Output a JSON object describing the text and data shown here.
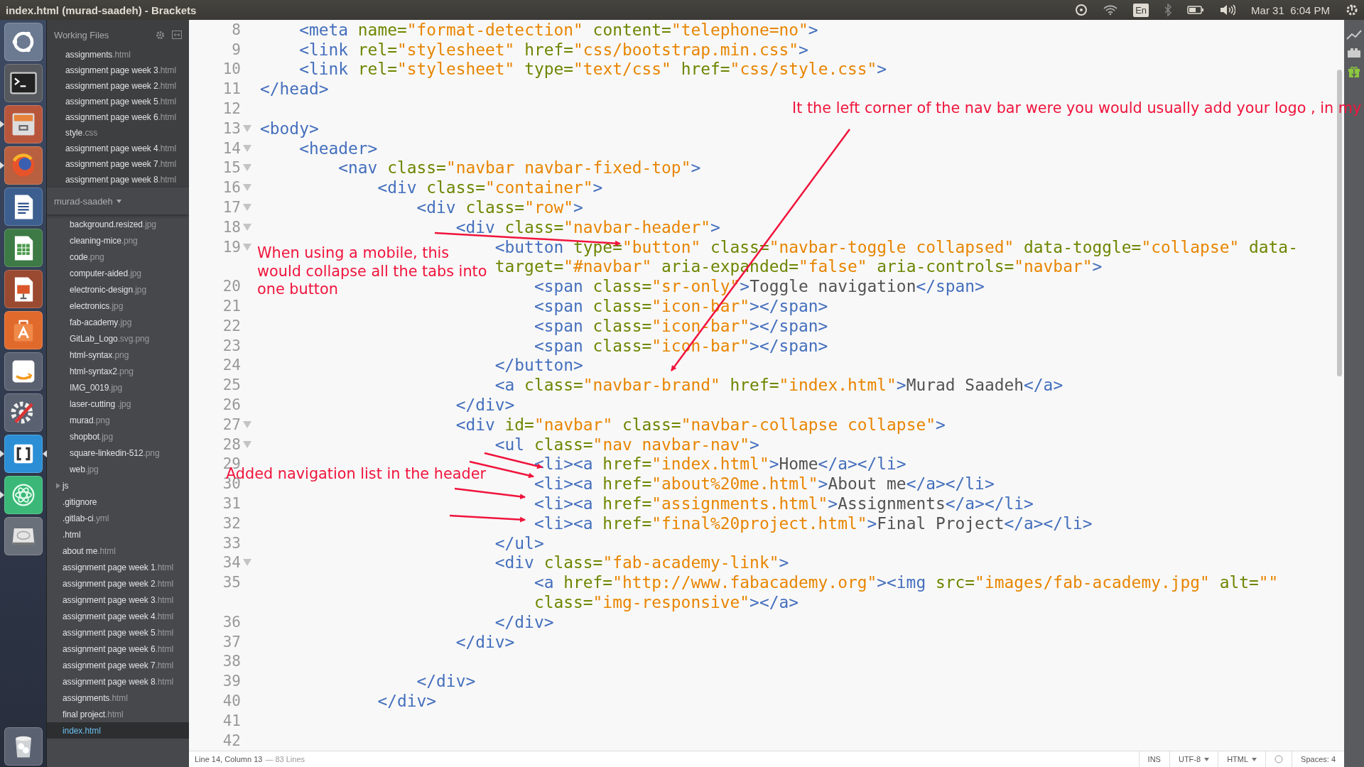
{
  "window": {
    "title": "index.html (murad-saadeh) - Brackets"
  },
  "panel": {
    "keyboard_layout": "En",
    "clock": "Mar 31  6:04 PM"
  },
  "launcher": [
    {
      "kind": "dash",
      "running": false,
      "focused": false
    },
    {
      "kind": "terminal",
      "running": false,
      "focused": false
    },
    {
      "kind": "files",
      "running": true,
      "focused": false
    },
    {
      "kind": "firefox",
      "running": true,
      "focused": false
    },
    {
      "kind": "writer",
      "running": false,
      "focused": false
    },
    {
      "kind": "calc",
      "running": false,
      "focused": false
    },
    {
      "kind": "impress",
      "running": false,
      "focused": false
    },
    {
      "kind": "software",
      "running": false,
      "focused": false
    },
    {
      "kind": "amazon",
      "running": false,
      "focused": false
    },
    {
      "kind": "settings",
      "running": false,
      "focused": false
    },
    {
      "kind": "brackets",
      "running": true,
      "focused": true
    },
    {
      "kind": "atom",
      "running": true,
      "focused": false
    },
    {
      "kind": "disk",
      "running": false,
      "focused": false
    },
    {
      "kind": "trash",
      "running": false,
      "focused": false
    }
  ],
  "sidebar": {
    "working_files_title": "Working Files",
    "working_files": [
      {
        "name": "assignments",
        "ext": ".html",
        "selected": false
      },
      {
        "name": "assignment page week 3",
        "ext": ".html",
        "selected": false
      },
      {
        "name": "assignment page week 2",
        "ext": ".html",
        "selected": false
      },
      {
        "name": "assignment page week 5",
        "ext": ".html",
        "selected": false
      },
      {
        "name": "assignment page week 6",
        "ext": ".html",
        "selected": false
      },
      {
        "name": "style",
        "ext": ".css",
        "selected": false
      },
      {
        "name": "assignment page week 4",
        "ext": ".html",
        "selected": false
      },
      {
        "name": "assignment page week 7",
        "ext": ".html",
        "selected": false
      },
      {
        "name": "assignment page week 8",
        "ext": ".html",
        "selected": false
      }
    ],
    "project_title": "murad-saadeh",
    "nested_files": [
      {
        "name": "background.resized",
        "ext": ".jpg",
        "selected": false
      },
      {
        "name": "cleaning-mice",
        "ext": ".png",
        "selected": false
      },
      {
        "name": "code",
        "ext": ".png",
        "selected": false
      },
      {
        "name": "computer-aided",
        "ext": ".jpg",
        "selected": false
      },
      {
        "name": "electronic-design",
        "ext": ".jpg",
        "selected": false
      },
      {
        "name": "electronics",
        "ext": ".jpg",
        "selected": false
      },
      {
        "name": "fab-academy",
        "ext": ".jpg",
        "selected": false
      },
      {
        "name": "GitLab_Logo",
        "ext": ".svg.png",
        "selected": false
      },
      {
        "name": "html-syntax",
        "ext": ".png",
        "selected": false
      },
      {
        "name": "html-syntax2",
        "ext": ".png",
        "selected": false
      },
      {
        "name": "IMG_0019",
        "ext": ".jpg",
        "selected": false
      },
      {
        "name": "laser-cutting ",
        "ext": ".jpg",
        "selected": false
      },
      {
        "name": "murad",
        "ext": ".png",
        "selected": false
      },
      {
        "name": "shopbot",
        "ext": ".jpg",
        "selected": false
      },
      {
        "name": "square-linkedin-512",
        "ext": ".png",
        "selected": false
      },
      {
        "name": "web",
        "ext": ".jpg",
        "selected": false
      }
    ],
    "project_items": [
      {
        "kind": "folder",
        "name": "js",
        "expanded": false,
        "selected": false
      },
      {
        "kind": "file",
        "name": ".gitignore",
        "selected": false
      },
      {
        "kind": "file",
        "name": ".gitlab-ci",
        "ext": ".yml",
        "selected": false
      },
      {
        "kind": "file",
        "name": ".html",
        "selected": false
      },
      {
        "kind": "file",
        "name": "about me",
        "ext": ".html",
        "selected": false
      },
      {
        "kind": "file",
        "name": "assignment page week 1",
        "ext": ".html",
        "selected": false
      },
      {
        "kind": "file",
        "name": "assignment page week 2",
        "ext": ".html",
        "selected": false
      },
      {
        "kind": "file",
        "name": "assignment page week 3",
        "ext": ".html",
        "selected": false
      },
      {
        "kind": "file",
        "name": "assignment page week 4",
        "ext": ".html",
        "selected": false
      },
      {
        "kind": "file",
        "name": "assignment page week 5",
        "ext": ".html",
        "selected": false
      },
      {
        "kind": "file",
        "name": "assignment page week 6",
        "ext": ".html",
        "selected": false
      },
      {
        "kind": "file",
        "name": "assignment page week 7",
        "ext": ".html",
        "selected": false
      },
      {
        "kind": "file",
        "name": "assignment page week 8",
        "ext": ".html",
        "selected": false
      },
      {
        "kind": "file",
        "name": "assignments",
        "ext": ".html",
        "selected": false
      },
      {
        "kind": "file",
        "name": "final project",
        "ext": ".html",
        "selected": false
      },
      {
        "kind": "file",
        "name": "index.html",
        "selected": true
      }
    ]
  },
  "code_lines": [
    {
      "number": "8",
      "fold": false,
      "segments": [
        {
          "kind": "tag",
          "text": "    <meta"
        },
        {
          "kind": "attr",
          "text": " name="
        },
        {
          "kind": "str",
          "text": "\"format-detection\""
        },
        {
          "kind": "attr",
          "text": " content="
        },
        {
          "kind": "str",
          "text": "\"telephone=no\""
        },
        {
          "kind": "tag",
          "text": ">"
        }
      ]
    },
    {
      "number": "9",
      "fold": false,
      "segments": [
        {
          "kind": "tag",
          "text": "    <link"
        },
        {
          "kind": "attr",
          "text": " rel="
        },
        {
          "kind": "str",
          "text": "\"stylesheet\""
        },
        {
          "kind": "attr",
          "text": " href="
        },
        {
          "kind": "str",
          "text": "\"css/bootstrap.min.css\""
        },
        {
          "kind": "tag",
          "text": ">"
        }
      ]
    },
    {
      "number": "10",
      "fold": false,
      "segments": [
        {
          "kind": "tag",
          "text": "    <link"
        },
        {
          "kind": "attr",
          "text": " rel="
        },
        {
          "kind": "str",
          "text": "\"stylesheet\""
        },
        {
          "kind": "attr",
          "text": " type="
        },
        {
          "kind": "str",
          "text": "\"text/css\""
        },
        {
          "kind": "attr",
          "text": " href="
        },
        {
          "kind": "str",
          "text": "\"css/style.css\""
        },
        {
          "kind": "tag",
          "text": ">"
        }
      ]
    },
    {
      "number": "11",
      "fold": false,
      "segments": [
        {
          "kind": "tag",
          "text": "</head>"
        }
      ]
    },
    {
      "number": "12",
      "fold": false
    },
    {
      "number": "13",
      "fold": true,
      "segments": [
        {
          "kind": "tag",
          "text": "<body>"
        }
      ]
    },
    {
      "number": "14",
      "fold": true,
      "segments": [
        {
          "kind": "tag",
          "text": "    <header>"
        }
      ]
    },
    {
      "number": "15",
      "fold": true,
      "segments": [
        {
          "kind": "tag",
          "text": "        <nav"
        },
        {
          "kind": "attr",
          "text": " class="
        },
        {
          "kind": "str",
          "text": "\"navbar navbar-fixed-top\""
        },
        {
          "kind": "tag",
          "text": ">"
        }
      ]
    },
    {
      "number": "16",
      "fold": true,
      "segments": [
        {
          "kind": "tag",
          "text": "            <div"
        },
        {
          "kind": "attr",
          "text": " class="
        },
        {
          "kind": "str",
          "text": "\"container\""
        },
        {
          "kind": "tag",
          "text": ">"
        }
      ]
    },
    {
      "number": "17",
      "fold": true,
      "segments": [
        {
          "kind": "tag",
          "text": "                <div"
        },
        {
          "kind": "attr",
          "text": " class="
        },
        {
          "kind": "str",
          "text": "\"row\""
        },
        {
          "kind": "tag",
          "text": ">"
        }
      ]
    },
    {
      "number": "18",
      "fold": true,
      "segments": [
        {
          "kind": "tag",
          "text": "                    <div"
        },
        {
          "kind": "attr",
          "text": " class="
        },
        {
          "kind": "str",
          "text": "\"navbar-header\""
        },
        {
          "kind": "tag",
          "text": ">"
        }
      ]
    },
    {
      "number": "19",
      "fold": true,
      "segments": [
        {
          "kind": "tag",
          "text": "                        <button"
        },
        {
          "kind": "attr",
          "text": " type="
        },
        {
          "kind": "str",
          "text": "\"button\""
        },
        {
          "kind": "attr",
          "text": " class="
        },
        {
          "kind": "str",
          "text": "\"navbar-toggle collapsed\""
        },
        {
          "kind": "attr",
          "text": " data-toggle="
        },
        {
          "kind": "str",
          "text": "\"collapse\""
        },
        {
          "kind": "attr",
          "text": " data-"
        }
      ]
    },
    {
      "segments": [
        {
          "kind": "attr",
          "text": "                        target="
        },
        {
          "kind": "str",
          "text": "\"#navbar\""
        },
        {
          "kind": "attr",
          "text": " aria-expanded="
        },
        {
          "kind": "str",
          "text": "\"false\""
        },
        {
          "kind": "attr",
          "text": " aria-controls="
        },
        {
          "kind": "str",
          "text": "\"navbar\""
        },
        {
          "kind": "tag",
          "text": ">"
        }
      ]
    },
    {
      "number": "20",
      "fold": false,
      "segments": [
        {
          "kind": "tag",
          "text": "                            <span"
        },
        {
          "kind": "attr",
          "text": " class="
        },
        {
          "kind": "str",
          "text": "\"sr-only\""
        },
        {
          "kind": "tag",
          "text": ">"
        },
        {
          "kind": "text",
          "text": "Toggle navigation"
        },
        {
          "kind": "tag",
          "text": "</span>"
        }
      ]
    },
    {
      "number": "21",
      "fold": false,
      "segments": [
        {
          "kind": "tag",
          "text": "                            <span"
        },
        {
          "kind": "attr",
          "text": " class="
        },
        {
          "kind": "str",
          "text": "\"icon-bar\""
        },
        {
          "kind": "tag",
          "text": "></span>"
        }
      ]
    },
    {
      "number": "22",
      "fold": false,
      "segments": [
        {
          "kind": "tag",
          "text": "                            <span"
        },
        {
          "kind": "attr",
          "text": " class="
        },
        {
          "kind": "str",
          "text": "\"icon-bar\""
        },
        {
          "kind": "tag",
          "text": "></span>"
        }
      ]
    },
    {
      "number": "23",
      "fold": false,
      "segments": [
        {
          "kind": "tag",
          "text": "                            <span"
        },
        {
          "kind": "attr",
          "text": " class="
        },
        {
          "kind": "str",
          "text": "\"icon-bar\""
        },
        {
          "kind": "tag",
          "text": "></span>"
        }
      ]
    },
    {
      "number": "24",
      "fold": false,
      "segments": [
        {
          "kind": "tag",
          "text": "                        </button>"
        }
      ]
    },
    {
      "number": "25",
      "fold": false,
      "segments": [
        {
          "kind": "tag",
          "text": "                        <a"
        },
        {
          "kind": "attr",
          "text": " class="
        },
        {
          "kind": "str",
          "text": "\"navbar-brand\""
        },
        {
          "kind": "attr",
          "text": " href="
        },
        {
          "kind": "str",
          "text": "\"index.html\""
        },
        {
          "kind": "tag",
          "text": ">"
        },
        {
          "kind": "text",
          "text": "Murad Saadeh"
        },
        {
          "kind": "tag",
          "text": "</a>"
        }
      ]
    },
    {
      "number": "26",
      "fold": false,
      "segments": [
        {
          "kind": "tag",
          "text": "                    </div>"
        }
      ]
    },
    {
      "number": "27",
      "fold": true,
      "segments": [
        {
          "kind": "tag",
          "text": "                    <div"
        },
        {
          "kind": "attr",
          "text": " id="
        },
        {
          "kind": "str",
          "text": "\"navbar\""
        },
        {
          "kind": "attr",
          "text": " class="
        },
        {
          "kind": "str",
          "text": "\"navbar-collapse collapse\""
        },
        {
          "kind": "tag",
          "text": ">"
        }
      ]
    },
    {
      "number": "28",
      "fold": true,
      "segments": [
        {
          "kind": "tag",
          "text": "                        <ul"
        },
        {
          "kind": "attr",
          "text": " class="
        },
        {
          "kind": "str",
          "text": "\"nav navbar-nav\""
        },
        {
          "kind": "tag",
          "text": ">"
        }
      ]
    },
    {
      "number": "29",
      "fold": false,
      "segments": [
        {
          "kind": "tag",
          "text": "                            <li><a"
        },
        {
          "kind": "attr",
          "text": " href="
        },
        {
          "kind": "str",
          "text": "\"index.html\""
        },
        {
          "kind": "tag",
          "text": ">"
        },
        {
          "kind": "text",
          "text": "Home"
        },
        {
          "kind": "tag",
          "text": "</a></li>"
        }
      ]
    },
    {
      "number": "30",
      "fold": false,
      "segments": [
        {
          "kind": "tag",
          "text": "                            <li><a"
        },
        {
          "kind": "attr",
          "text": " href="
        },
        {
          "kind": "str",
          "text": "\"about%20me.html\""
        },
        {
          "kind": "tag",
          "text": ">"
        },
        {
          "kind": "text",
          "text": "About me"
        },
        {
          "kind": "tag",
          "text": "</a></li>"
        }
      ]
    },
    {
      "number": "31",
      "fold": false,
      "segments": [
        {
          "kind": "tag",
          "text": "                            <li><a"
        },
        {
          "kind": "attr",
          "text": " href="
        },
        {
          "kind": "str",
          "text": "\"assignments.html\""
        },
        {
          "kind": "tag",
          "text": ">"
        },
        {
          "kind": "text",
          "text": "Assignments"
        },
        {
          "kind": "tag",
          "text": "</a></li>"
        }
      ]
    },
    {
      "number": "32",
      "fold": false,
      "segments": [
        {
          "kind": "tag",
          "text": "                            <li><a"
        },
        {
          "kind": "attr",
          "text": " href="
        },
        {
          "kind": "str",
          "text": "\"final%20project.html\""
        },
        {
          "kind": "tag",
          "text": ">"
        },
        {
          "kind": "text",
          "text": "Final Project"
        },
        {
          "kind": "tag",
          "text": "</a></li>"
        }
      ]
    },
    {
      "number": "33",
      "fold": false,
      "segments": [
        {
          "kind": "tag",
          "text": "                        </ul>"
        }
      ]
    },
    {
      "number": "34",
      "fold": true,
      "segments": [
        {
          "kind": "tag",
          "text": "                        <div"
        },
        {
          "kind": "attr",
          "text": " class="
        },
        {
          "kind": "str",
          "text": "\"fab-academy-link\""
        },
        {
          "kind": "tag",
          "text": ">"
        }
      ]
    },
    {
      "number": "35",
      "fold": false,
      "segments": [
        {
          "kind": "tag",
          "text": "                            <a"
        },
        {
          "kind": "attr",
          "text": " href="
        },
        {
          "kind": "str",
          "text": "\"http://www.fabacademy.org\""
        },
        {
          "kind": "tag",
          "text": "><img"
        },
        {
          "kind": "attr",
          "text": " src="
        },
        {
          "kind": "str",
          "text": "\"images/fab-academy.jpg\""
        },
        {
          "kind": "attr",
          "text": " alt="
        },
        {
          "kind": "str",
          "text": "\"\""
        }
      ]
    },
    {
      "segments": [
        {
          "kind": "attr",
          "text": "                            class="
        },
        {
          "kind": "str",
          "text": "\"img-responsive\""
        },
        {
          "kind": "tag",
          "text": "></a>"
        }
      ]
    },
    {
      "number": "36",
      "fold": false,
      "segments": [
        {
          "kind": "tag",
          "text": "                        </div>"
        }
      ]
    },
    {
      "number": "37",
      "fold": false,
      "segments": [
        {
          "kind": "tag",
          "text": "                    </div>"
        }
      ]
    },
    {
      "number": "38",
      "fold": false
    },
    {
      "number": "39",
      "fold": false,
      "segments": [
        {
          "kind": "tag",
          "text": "                </div>"
        }
      ]
    },
    {
      "number": "40",
      "fold": false,
      "segments": [
        {
          "kind": "tag",
          "text": "            </div>"
        }
      ]
    },
    {
      "number": "41",
      "fold": false
    },
    {
      "number": "42",
      "fold": false
    }
  ],
  "annotations": [
    {
      "text": "It the left corner of the nav bar were you would usually add your logo , in my"
    },
    {
      "text": "When using a mobile, this would collapse all the tabs into one button"
    },
    {
      "text": "Added navigation list in the header"
    }
  ],
  "status_bar": {
    "cursor": "Line 14, Column 13",
    "line_count": "— 83 Lines",
    "mode": "INS",
    "encoding": "UTF-8",
    "language": "HTML",
    "indent": "Spaces: 4"
  }
}
